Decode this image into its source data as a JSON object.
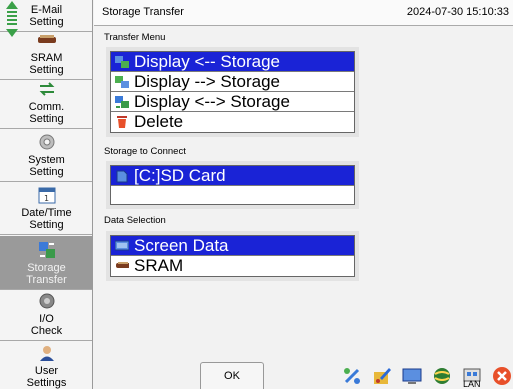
{
  "sidebar": {
    "items": [
      {
        "label": "E-Mail\nSetting",
        "icon": "email-icon"
      },
      {
        "label": "SRAM\nSetting",
        "icon": "sram-icon"
      },
      {
        "label": "Comm.\nSetting",
        "icon": "comm-icon"
      },
      {
        "label": "System\nSetting",
        "icon": "gear-icon"
      },
      {
        "label": "Date/Time\nSetting",
        "icon": "calendar-icon"
      },
      {
        "label": "Storage\nTransfer",
        "icon": "storage-transfer-icon",
        "active": true
      },
      {
        "label": "I/O\nCheck",
        "icon": "io-check-icon"
      },
      {
        "label": "User\nSettings",
        "icon": "user-icon"
      }
    ]
  },
  "header": {
    "title": "Storage Transfer",
    "datetime": "2024-07-30 15:10:33"
  },
  "transfer_menu": {
    "label": "Transfer Menu",
    "items": [
      {
        "label": "Display <-- Storage",
        "selected": true
      },
      {
        "label": "Display --> Storage",
        "selected": false
      },
      {
        "label": "Display <--> Storage",
        "selected": false
      },
      {
        "label": "Delete",
        "selected": false
      }
    ]
  },
  "storage_connect": {
    "label": "Storage to Connect",
    "items": [
      {
        "label": "[C:]SD Card",
        "selected": true
      }
    ]
  },
  "data_selection": {
    "label": "Data Selection",
    "items": [
      {
        "label": "Screen Data",
        "selected": true
      },
      {
        "label": "SRAM",
        "selected": false
      }
    ]
  },
  "footer": {
    "ok_label": "OK",
    "lan_label": "LAN",
    "tools": [
      "network-icon",
      "edit-icon",
      "monitor-icon",
      "globe-icon",
      "lan-icon",
      "close-icon"
    ]
  },
  "colors": {
    "selection": "#1a23d6",
    "sidebar_active": "#9a9a9a",
    "close": "#e8502a"
  }
}
